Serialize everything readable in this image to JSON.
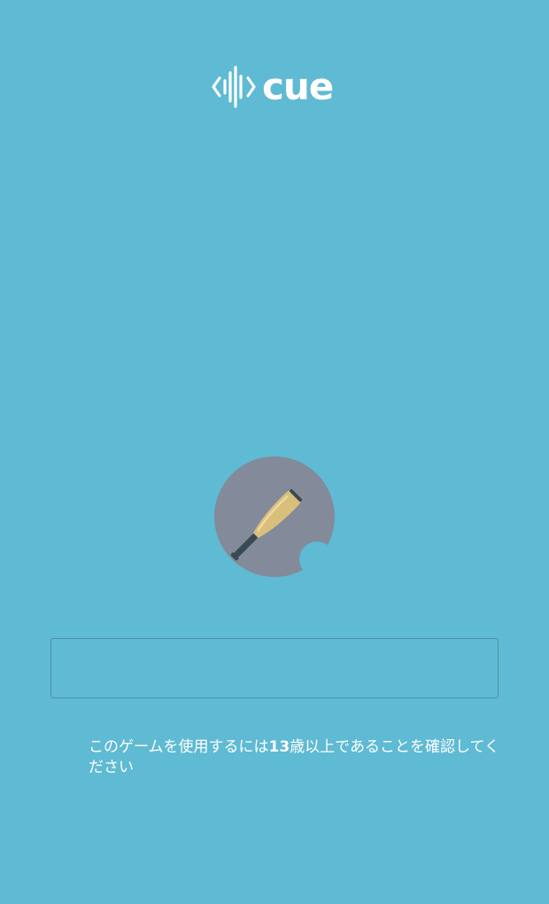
{
  "app": {
    "logo_text": "cue",
    "logo_icon": "audio-wave-brackets-icon"
  },
  "avatar": {
    "icon": "baseball-bat-icon",
    "colors": {
      "circle": "#838a99",
      "bat_wood": "#d9bf7c",
      "bat_grip": "#3a4a52"
    }
  },
  "age_field": {
    "value": "",
    "placeholder": ""
  },
  "notice": {
    "text_before": "このゲームを使用するには",
    "age": "13",
    "text_after": "歳以上であることを確認してください"
  },
  "colors": {
    "background": "#5fbad3",
    "text": "#ffffff",
    "field_border": "#4f8fa4"
  }
}
